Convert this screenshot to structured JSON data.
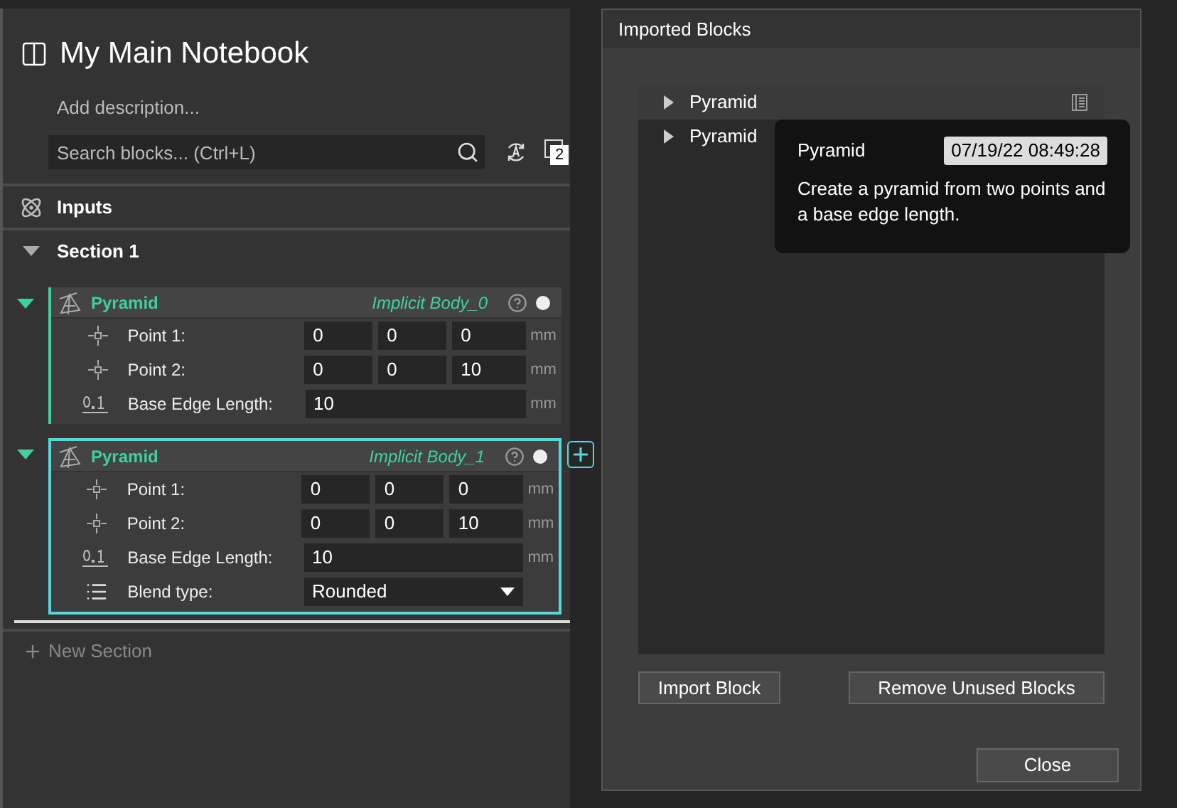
{
  "notebook": {
    "title": "My Main Notebook",
    "description": {
      "placeholder": "Add description..."
    },
    "search": {
      "placeholder": "Search blocks... (Ctrl+L)"
    },
    "count_badge": "2",
    "inputs": {
      "label": "Inputs"
    },
    "sections": [
      {
        "title": "Section 1",
        "expanded": true,
        "blocks": [
          {
            "name": "Pyramid",
            "body": "Implicit Body_0",
            "selected": false,
            "expanded": true,
            "params": [
              {
                "kind": "point",
                "label": "Point 1:",
                "values": [
                  "0",
                  "0",
                  "0"
                ],
                "unit": "mm"
              },
              {
                "kind": "point",
                "label": "Point 2:",
                "values": [
                  "0",
                  "0",
                  "10"
                ],
                "unit": "mm"
              },
              {
                "kind": "number",
                "label": "Base Edge Length:",
                "value": "10",
                "unit": "mm"
              }
            ]
          },
          {
            "name": "Pyramid",
            "body": "Implicit Body_1",
            "selected": true,
            "expanded": true,
            "params": [
              {
                "kind": "point",
                "label": "Point 1:",
                "values": [
                  "0",
                  "0",
                  "0"
                ],
                "unit": "mm"
              },
              {
                "kind": "point",
                "label": "Point 2:",
                "values": [
                  "0",
                  "0",
                  "10"
                ],
                "unit": "mm"
              },
              {
                "kind": "number",
                "label": "Base Edge Length:",
                "value": "10",
                "unit": "mm"
              },
              {
                "kind": "dropdown",
                "label": "Blend type:",
                "value": "Rounded"
              }
            ]
          }
        ]
      }
    ],
    "new_section": "New Section"
  },
  "dialog": {
    "title": "Imported Blocks",
    "items": [
      {
        "label": "Pyramid",
        "expanded": false,
        "selected": true
      },
      {
        "label": "Pyramid",
        "expanded": false,
        "selected": false
      }
    ],
    "tooltip": {
      "title": "Pyramid",
      "date": "07/19/22 08:49:28",
      "description": "Create a pyramid from two points and a base edge length."
    },
    "buttons": [
      "Import Block",
      "Remove Unused Blocks"
    ],
    "close": "Close"
  }
}
